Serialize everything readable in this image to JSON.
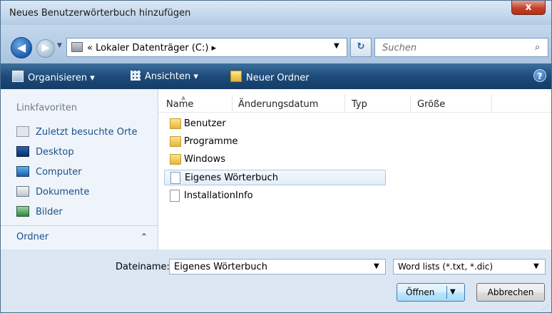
{
  "window": {
    "title": "Neues Benutzerwörterbuch hinzufügen",
    "close_label": "x"
  },
  "address": {
    "back_glyph": "◀",
    "forward_glyph": "▶",
    "history_glyph": "▼",
    "path": "« Lokaler Datenträger (C:) ▸",
    "drop_glyph": "▼",
    "refresh_glyph": "↻"
  },
  "search": {
    "placeholder": "Suchen",
    "icon_glyph": "⌕"
  },
  "toolbar": {
    "organize_label": "Organisieren ▾",
    "views_label": "Ansichten ▾",
    "new_folder_label": "Neuer Ordner",
    "help_label": "?"
  },
  "navpane": {
    "favorites_header": "Linkfavoriten",
    "items": [
      {
        "label": "Zuletzt besuchte Orte",
        "icon": "recent-places-icon"
      },
      {
        "label": "Desktop",
        "icon": "desktop-icon"
      },
      {
        "label": "Computer",
        "icon": "computer-icon"
      },
      {
        "label": "Dokumente",
        "icon": "documents-icon"
      },
      {
        "label": "Bilder",
        "icon": "pictures-icon"
      }
    ],
    "folders_label": "Ordner",
    "folders_chevron": "⌃"
  },
  "filelist": {
    "columns": [
      "Name",
      "Änderungsdatum",
      "Typ",
      "Größe"
    ],
    "sort_glyph": "▲",
    "items": [
      {
        "name": "Benutzer",
        "type": "folder"
      },
      {
        "name": "Programme",
        "type": "folder"
      },
      {
        "name": "Windows",
        "type": "folder"
      },
      {
        "name": "Eigenes Wörterbuch",
        "type": "file",
        "selected": true
      },
      {
        "name": "InstallationInfo",
        "type": "file"
      }
    ]
  },
  "bottom": {
    "filename_label": "Dateiname:",
    "filename_value": "Eigenes Wörterbuch",
    "filename_drop": "▼",
    "filter_value": "Word lists (*.txt, *.dic)",
    "filter_drop": "▼",
    "open_label": "Öffnen",
    "open_arrow": "▼",
    "cancel_label": "Abbrechen",
    "grip_glyph": "⋰"
  },
  "colors": {
    "toolbar": "#1d4b7a",
    "link": "#1a4f8b",
    "selection_border": "#a8c8e8"
  }
}
